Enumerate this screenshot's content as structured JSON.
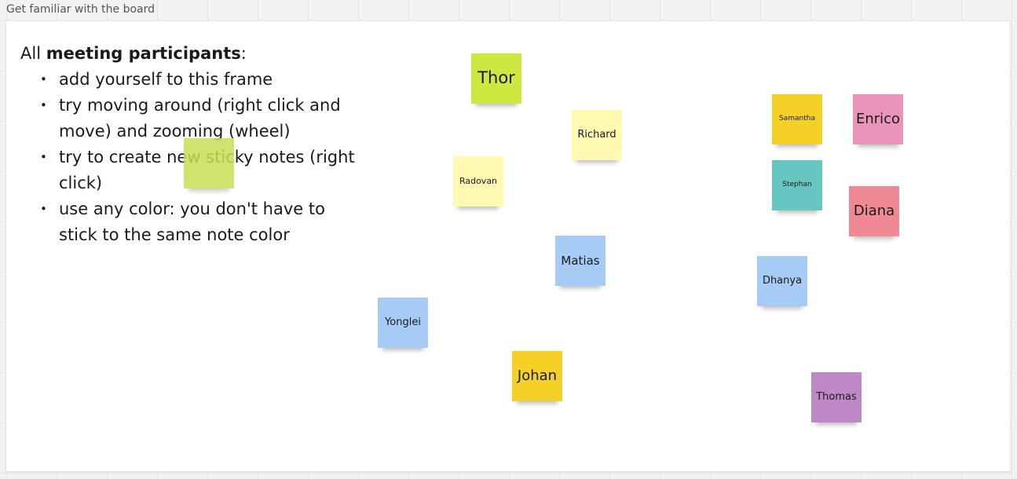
{
  "frame": {
    "title": "Get familiar with the board"
  },
  "instructions": {
    "intro_prefix": "All ",
    "intro_bold": "meeting participants",
    "intro_suffix": ":",
    "bullets": [
      "add yourself to this frame",
      "try moving around (right click and move) and zooming (wheel)",
      "try to create new sticky notes (right click)",
      "use any color: you don't have to stick to the same note color"
    ]
  },
  "colors": {
    "lime": "#cee741",
    "yellow": "#fff9b1",
    "gold": "#f5d128",
    "blue": "#a6ccf5",
    "teal": "#67c6c0",
    "pink": "#ea94bb",
    "red": "#ef8a94",
    "violet": "#be88c7"
  },
  "sticky_notes": {
    "thor": "Thor",
    "richard": "Richard",
    "radovan": "Radovan",
    "blank": "",
    "matias": "Matias",
    "yonglei": "Yonglei",
    "johan": "Johan",
    "samantha": "Samantha",
    "enrico": "Enrico",
    "stephan": "Stephan",
    "diana": "Diana",
    "dhanya": "Dhanya",
    "thomas": "Thomas"
  }
}
